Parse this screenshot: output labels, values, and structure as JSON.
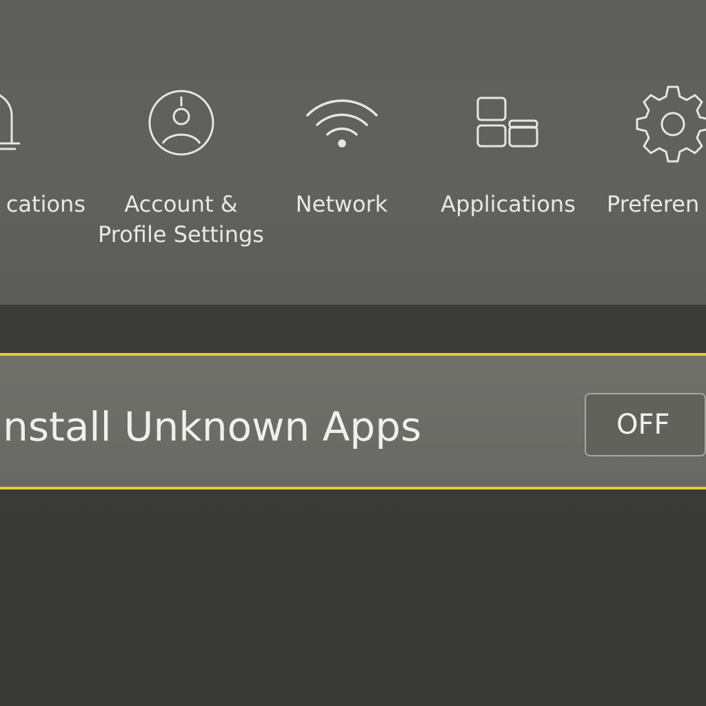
{
  "menu": {
    "items": [
      {
        "label": "cations",
        "icon": "bell-icon"
      },
      {
        "label": "Account &\nProfile Settings",
        "icon": "user-profile-icon"
      },
      {
        "label": "Network",
        "icon": "wifi-icon"
      },
      {
        "label": "Applications",
        "icon": "apps-icon"
      },
      {
        "label": "Preferen",
        "icon": "gear-icon"
      }
    ]
  },
  "setting": {
    "label": "install Unknown Apps",
    "value": "OFF"
  },
  "colors": {
    "focus_border": "#e3cc33",
    "panel": "#5e5e5a",
    "background": "#3b3b37",
    "text": "#e9e9e6"
  }
}
